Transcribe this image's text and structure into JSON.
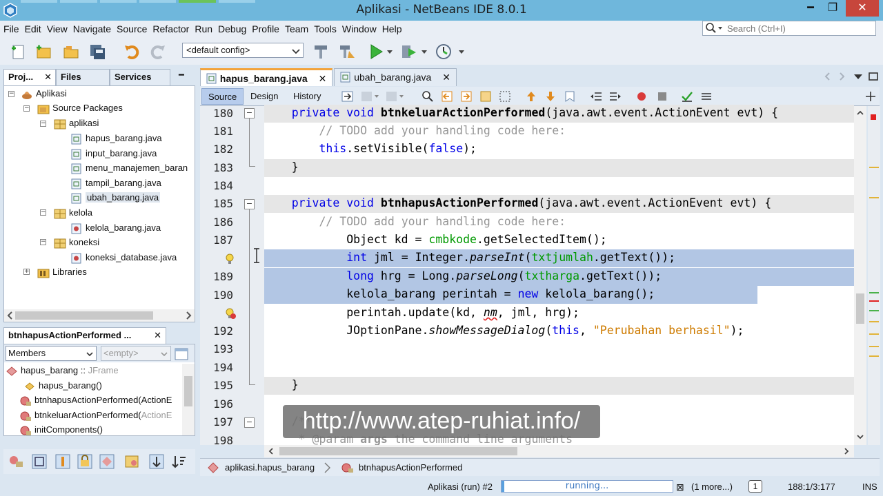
{
  "window": {
    "title": "Aplikasi - NetBeans IDE 8.0.1",
    "min_glyph": "━",
    "max_glyph": "❐",
    "close_glyph": "✕"
  },
  "menu": [
    "File",
    "Edit",
    "View",
    "Navigate",
    "Source",
    "Refactor",
    "Run",
    "Debug",
    "Profile",
    "Team",
    "Tools",
    "Window",
    "Help"
  ],
  "search": {
    "placeholder": "Search (Ctrl+I)"
  },
  "toolbar": {
    "config": "<default config>"
  },
  "projects_panel": {
    "tabs": [
      "Proj...",
      "Files",
      "Services"
    ],
    "close_glyph": "✕",
    "minimize_glyph": "━",
    "tree": [
      {
        "label": "Aplikasi",
        "icon": "project-icon"
      },
      {
        "label": "Source Packages",
        "icon": "source-packages-icon"
      },
      {
        "label": "aplikasi",
        "icon": "package-icon"
      },
      {
        "label": "hapus_barang.java",
        "icon": "java-form-icon"
      },
      {
        "label": "input_barang.java",
        "icon": "java-form-icon"
      },
      {
        "label": "menu_manajemen_baran",
        "icon": "java-form-icon"
      },
      {
        "label": "tampil_barang.java",
        "icon": "java-form-icon"
      },
      {
        "label": "ubah_barang.java",
        "icon": "java-form-icon"
      },
      {
        "label": "kelola",
        "icon": "package-icon"
      },
      {
        "label": "kelola_barang.java",
        "icon": "java-class-icon"
      },
      {
        "label": "koneksi",
        "icon": "package-icon"
      },
      {
        "label": "koneksi_database.java",
        "icon": "java-class-icon"
      },
      {
        "label": "Libraries",
        "icon": "libraries-icon"
      }
    ]
  },
  "navigator_panel": {
    "title": "btnhapusActionPerformed ...",
    "close_glyph": "✕",
    "filter": "Members",
    "filter2": "<empty>",
    "items": [
      {
        "label": "hapus_barang :: ",
        "suffix": "JFrame"
      },
      {
        "label": "hapus_barang()",
        "suffix": ""
      },
      {
        "label": "btnhapusActionPerformed(ActionE",
        "suffix": ""
      },
      {
        "label": "btnkeluarActionPerformed(",
        "suffix": "ActionE"
      },
      {
        "label": "initComponents()",
        "suffix": ""
      }
    ]
  },
  "editor": {
    "tabs": [
      {
        "label": "hapus_barang.java",
        "close": "✕"
      },
      {
        "label": "ubah_barang.java",
        "close": "✕"
      }
    ],
    "view_tabs": [
      "Source",
      "Design",
      "History"
    ],
    "line_numbers": [
      "180",
      "181",
      "182",
      "183",
      "184",
      "185",
      "186",
      "187",
      "",
      "189",
      "190",
      "",
      "192",
      "193",
      "194",
      "195",
      "196",
      "197",
      "198"
    ],
    "fold_glyph": "−",
    "watermark": "http://www.atep-ruhiat.info/"
  },
  "breadcrumb": [
    "aplikasi.hapus_barang",
    "btnhapusActionPerformed"
  ],
  "status": {
    "run_label": "Aplikasi (run) #2",
    "progress_text": "running...",
    "more": "(1 more...)",
    "notifications": "1",
    "position": "188:1/3:177",
    "mode": "INS"
  }
}
